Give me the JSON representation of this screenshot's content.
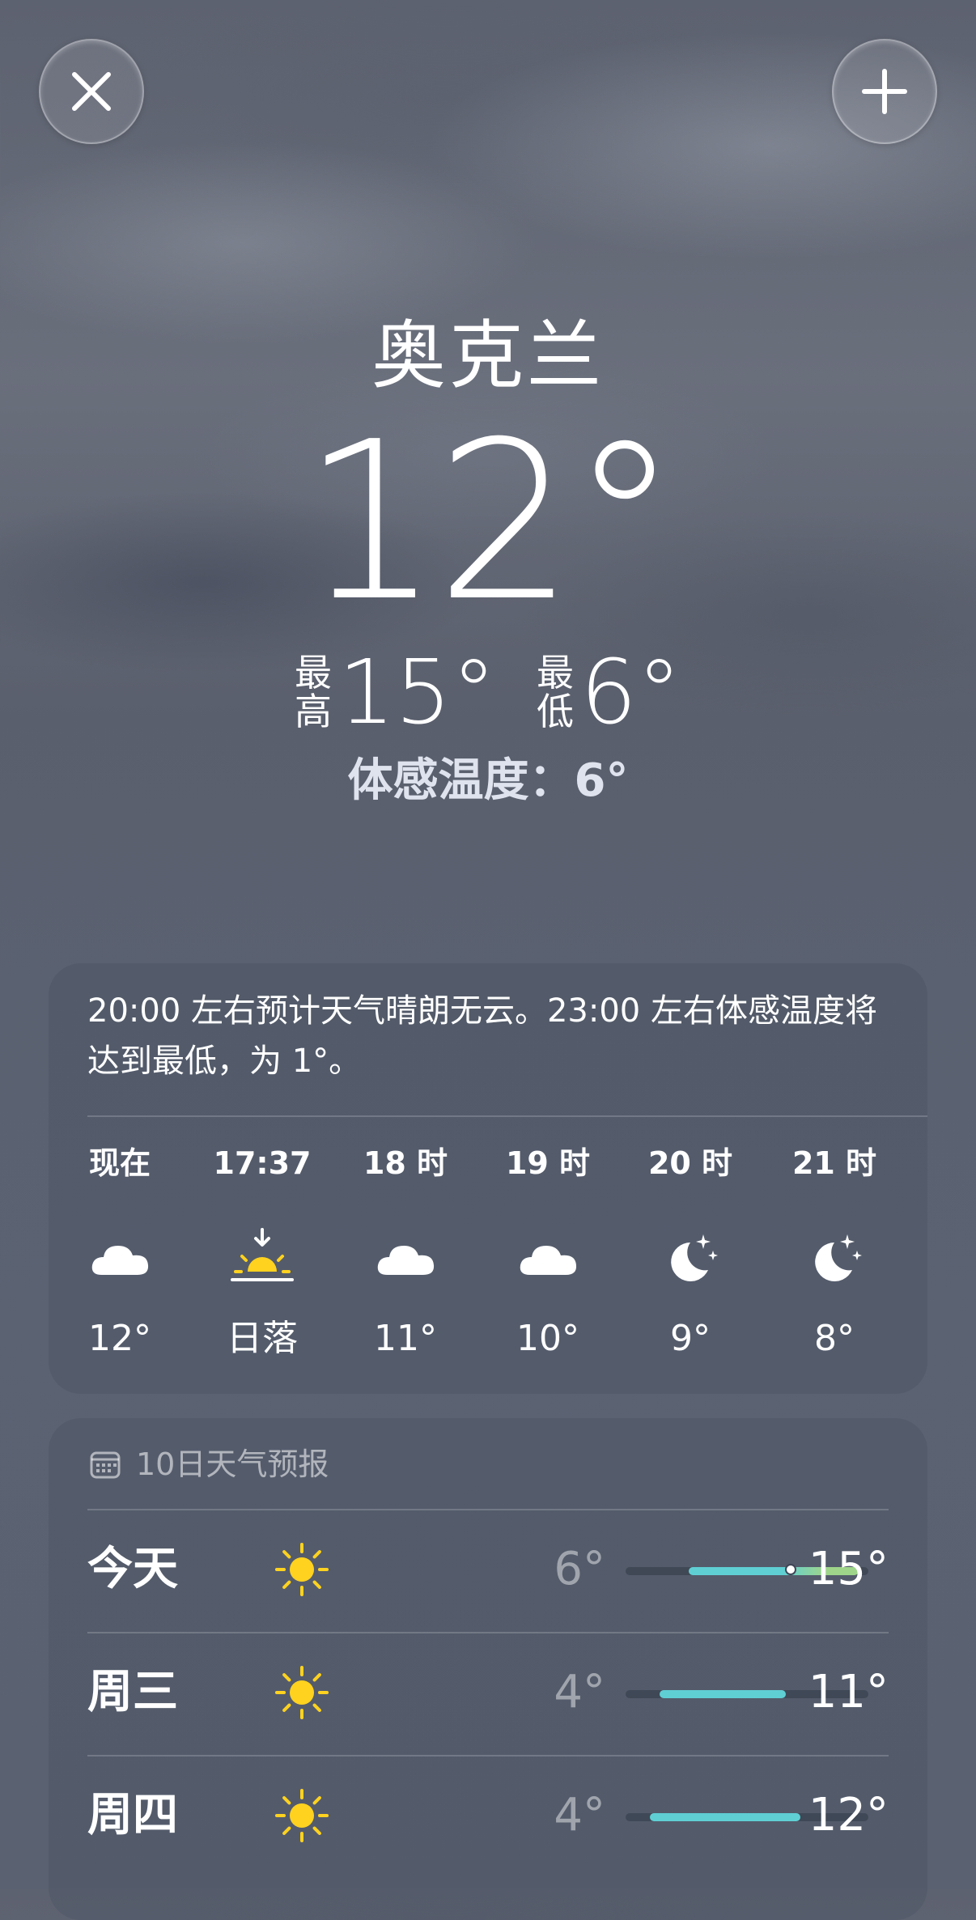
{
  "header": {
    "close_icon": "close-icon",
    "add_icon": "plus-icon"
  },
  "current": {
    "city": "奥克兰",
    "temperature": "12°",
    "high_label": "最高",
    "high_value": "15°",
    "low_label": "最低",
    "low_value": "6°",
    "feels_like": "体感温度：6°"
  },
  "hourly": {
    "summary": "20:00 左右预计天气晴朗无云。23:00 左右体感温度将达到最低，为 1°。",
    "items": [
      {
        "label": "现在",
        "icon": "cloud-icon",
        "value": "12°"
      },
      {
        "label": "17:37",
        "icon": "sunset-icon",
        "value": "日落"
      },
      {
        "label": "18 时",
        "icon": "cloud-icon",
        "value": "11°"
      },
      {
        "label": "19 时",
        "icon": "cloud-icon",
        "value": "10°"
      },
      {
        "label": "20 时",
        "icon": "moon-stars-icon",
        "value": "9°"
      },
      {
        "label": "21 时",
        "icon": "moon-stars-icon",
        "value": "8°"
      }
    ]
  },
  "daily": {
    "header": "10日天气预报",
    "header_icon": "calendar-icon",
    "days": [
      {
        "name": "今天",
        "icon": "sun-icon",
        "low": "6°",
        "high": "15°",
        "range_start": 0.26,
        "range_end": 0.96,
        "current_marker": 0.68
      },
      {
        "name": "周三",
        "icon": "sun-icon",
        "low": "4°",
        "high": "11°",
        "range_start": 0.14,
        "range_end": 0.66
      },
      {
        "name": "周四",
        "icon": "sun-icon",
        "low": "4°",
        "high": "12°",
        "range_start": 0.1,
        "range_end": 0.72
      }
    ]
  },
  "colors": {
    "range_cool": "#5fcfd4",
    "range_warm": "#9ed58a",
    "sun": "#ffd21f"
  }
}
